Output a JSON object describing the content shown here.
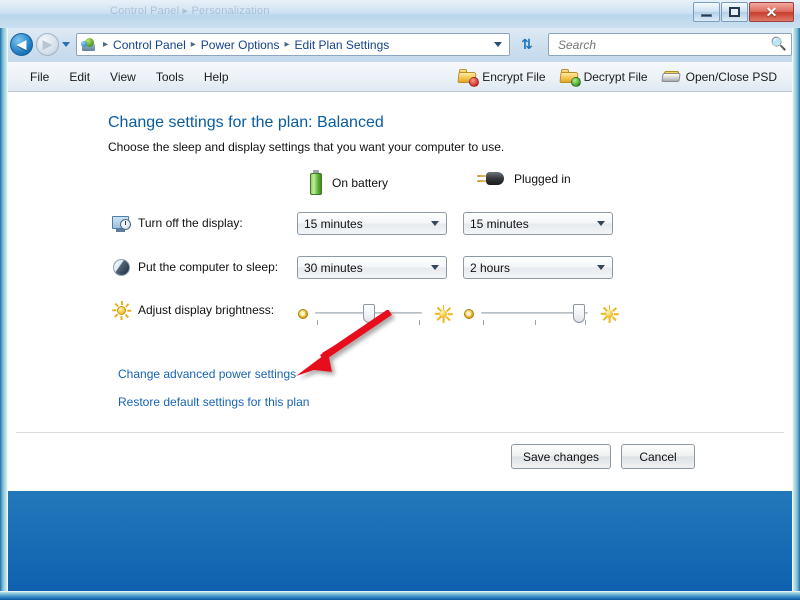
{
  "titlebar": {
    "ghost_text": "Control Panel  ▸  Personalization",
    "minimize_label": "Minimize",
    "maximize_label": "Maximize",
    "close_label": "✕"
  },
  "navbar": {
    "back_label": "◀",
    "forward_label": "▶",
    "history_dropdown": "history-dropdown",
    "breadcrumbs": [
      {
        "label": "Control Panel"
      },
      {
        "label": "Power Options"
      },
      {
        "label": "Edit Plan Settings"
      }
    ],
    "separator": "▸",
    "refresh_label": "⇅",
    "search": {
      "placeholder": "Search",
      "value": "",
      "icon": "search-icon"
    }
  },
  "menubar": {
    "items": [
      {
        "label": "File"
      },
      {
        "label": "Edit"
      },
      {
        "label": "View"
      },
      {
        "label": "Tools"
      },
      {
        "label": "Help"
      }
    ],
    "toolbar": [
      {
        "label": "Encrypt File",
        "icon": "folder-lock-red-icon"
      },
      {
        "label": "Decrypt File",
        "icon": "folder-unlock-green-icon"
      },
      {
        "label": "Open/Close PSD",
        "icon": "drive-icon"
      }
    ]
  },
  "main": {
    "title": "Change settings for the plan: Balanced",
    "subtitle": "Choose the sleep and display settings that you want your computer to use.",
    "columns": [
      {
        "label": "On battery",
        "icon": "battery-icon"
      },
      {
        "label": "Plugged in",
        "icon": "power-plug-icon"
      }
    ],
    "rows": [
      {
        "label": "Turn off the display:",
        "icon": "display-clock-icon",
        "battery_value": "15 minutes",
        "plugged_value": "15 minutes"
      },
      {
        "label": "Put the computer to sleep:",
        "icon": "sleep-moon-icon",
        "battery_value": "30 minutes",
        "plugged_value": "2 hours"
      }
    ],
    "brightness": {
      "label": "Adjust display brightness:",
      "icon": "brightness-sun-icon",
      "battery_percent": 50,
      "plugged_percent": 92
    },
    "links": [
      {
        "label": "Change advanced power settings"
      },
      {
        "label": "Restore default settings for this plan"
      }
    ],
    "buttons": [
      {
        "label": "Save changes"
      },
      {
        "label": "Cancel"
      }
    ]
  },
  "annotation": {
    "arrow_color": "#e8111b",
    "points_to": "Change advanced power settings"
  }
}
